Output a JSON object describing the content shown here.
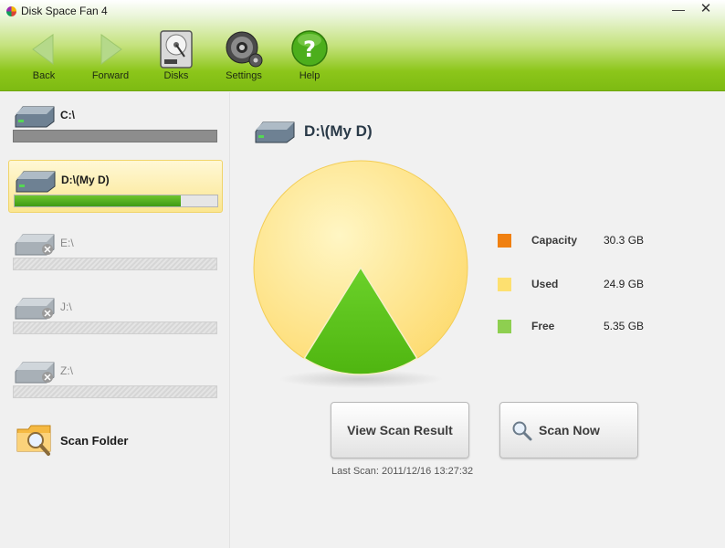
{
  "window": {
    "title": "Disk Space Fan 4",
    "minimize": "—",
    "close": "✕"
  },
  "toolbar": {
    "back": {
      "label": "Back",
      "icon": "arrow-left-icon"
    },
    "forward": {
      "label": "Forward",
      "icon": "arrow-right-icon"
    },
    "disks": {
      "label": "Disks",
      "icon": "hard-disk-icon"
    },
    "settings": {
      "label": "Settings",
      "icon": "gear-icon"
    },
    "help": {
      "label": "Help",
      "icon": "help-icon"
    }
  },
  "sidebar": {
    "disks": [
      {
        "label": "C:\\",
        "state": "available",
        "used_fraction": 1.0
      },
      {
        "label": "D:\\(My D)",
        "state": "selected",
        "used_fraction": 0.82
      },
      {
        "label": "E:\\",
        "state": "unavailable"
      },
      {
        "label": "J:\\",
        "state": "unavailable"
      },
      {
        "label": "Z:\\",
        "state": "unavailable"
      }
    ],
    "scan_folder": "Scan Folder"
  },
  "main": {
    "drive_title": "D:\\(My D)",
    "legend": [
      {
        "label": "Capacity",
        "value": "30.3 GB",
        "color": "#f08010"
      },
      {
        "label": "Used",
        "value": "24.9 GB",
        "color": "#fde070"
      },
      {
        "label": "Free",
        "value": "5.35 GB",
        "color": "#8ecf50"
      }
    ],
    "view_scan_result": "View Scan Result",
    "scan_now": "Scan Now",
    "last_scan": "Last Scan: 2011/12/16 13:27:32"
  },
  "chart_data": {
    "type": "pie",
    "slices": [
      {
        "name": "Used",
        "value": 24.9,
        "color": "#fde070"
      },
      {
        "name": "Free",
        "value": 5.35,
        "color": "#5cc21a"
      }
    ]
  }
}
